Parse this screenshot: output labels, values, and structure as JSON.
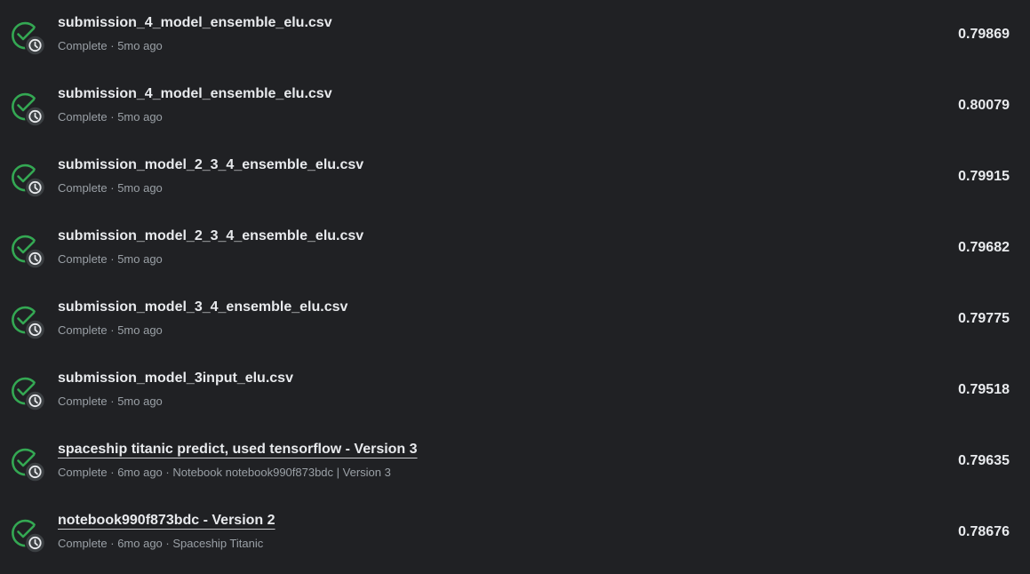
{
  "colors": {
    "background": "#202124",
    "success": "#34a853",
    "badge": "#3c4043",
    "text": "#e8eaed",
    "muted": "#9aa0a6"
  },
  "submissions": [
    {
      "title": "submission_4_model_ensemble_elu.csv",
      "meta": "Complete · 5mo ago",
      "score": "0.79869",
      "icon": "check-circle-icon"
    },
    {
      "title": "submission_4_model_ensemble_elu.csv",
      "meta": "Complete · 5mo ago",
      "score": "0.80079",
      "icon": "check-circle-icon"
    },
    {
      "title": "submission_model_2_3_4_ensemble_elu.csv",
      "meta": "Complete · 5mo ago",
      "score": "0.79915",
      "icon": "check-circle-icon"
    },
    {
      "title": "submission_model_2_3_4_ensemble_elu.csv",
      "meta": "Complete · 5mo ago",
      "score": "0.79682",
      "icon": "check-circle-icon"
    },
    {
      "title": "submission_model_3_4_ensemble_elu.csv",
      "meta": "Complete · 5mo ago",
      "score": "0.79775",
      "icon": "check-circle-icon"
    },
    {
      "title": "submission_model_3input_elu.csv",
      "meta": "Complete · 5mo ago",
      "score": "0.79518",
      "icon": "check-circle-icon"
    },
    {
      "title": "spaceship titanic predict, used tensorflow - Version 3",
      "meta": "Complete · 6mo ago · Notebook notebook990f873bdc | Version 3",
      "score": "0.79635",
      "icon": "check-circle-icon"
    },
    {
      "title": "notebook990f873bdc - Version 2",
      "meta": "Complete · 6mo ago · Spaceship Titanic",
      "score": "0.78676",
      "icon": "check-circle-icon"
    }
  ]
}
